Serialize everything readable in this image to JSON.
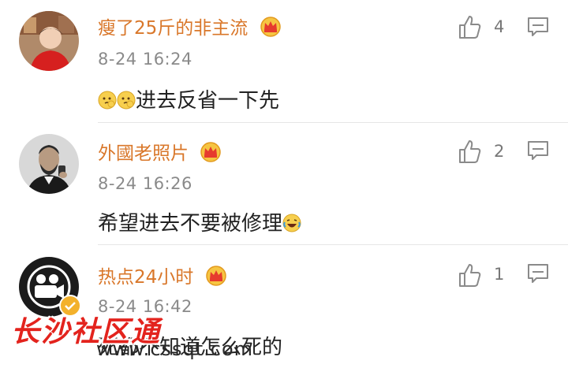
{
  "comments": [
    {
      "username": "瘦了25斤的非主流",
      "time": "8-24 16:24",
      "text": "进去反省一下先",
      "likes": "4",
      "emoji_before": [
        "thinking-face-emoji",
        "thinking-face-emoji"
      ],
      "avatar": "red-jacket-person-avatar"
    },
    {
      "username": "外國老照片",
      "time": "8-24 16:26",
      "text": "希望进去不要被修理",
      "likes": "2",
      "emoji_after": [
        "laughing-crying-emoji"
      ],
      "avatar": "lincoln-portrait-avatar"
    },
    {
      "username": "热点24小时",
      "time": "8-24 16:42",
      "text": "死都不知道怎么死的",
      "likes": "1",
      "avatar": "video-camera-logo-avatar",
      "verified": true
    }
  ],
  "watermark": {
    "text": "长沙社区通",
    "url": "www.cssqt.com"
  },
  "colors": {
    "username": "#d9772a",
    "time": "#8a8a8a",
    "watermark": "#e3231d"
  }
}
